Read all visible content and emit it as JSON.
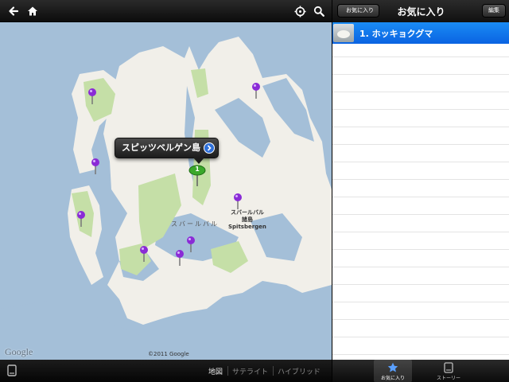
{
  "map": {
    "topbar": {
      "back_icon": "arrow-left-icon",
      "home_icon": "home-icon",
      "locate_icon": "crosshair-icon",
      "search_icon": "search-icon"
    },
    "callout": {
      "title": "スピッツベルゲン島",
      "disclosure_icon": "chevron-right-circle-icon"
    },
    "selected_pin_number": "1",
    "labels": {
      "island_ja": "スバールバル",
      "archipelago_ja_line1": "スバールバル",
      "archipelago_ja_line2": "諸島",
      "archipelago_en": "Spitsbergen"
    },
    "logo_text": "Google",
    "copyright": "©2011 Google",
    "bottombar": {
      "book_icon": "book-icon",
      "segments": [
        "地図",
        "サテライト",
        "ハイブリッド"
      ],
      "active_segment": "地図"
    },
    "colors": {
      "water": "#a4bfd8",
      "land": "#f1efe9",
      "park": "#c5dfa7",
      "pin_purple": "#8a2bd6",
      "pin_green": "#3aa82b"
    }
  },
  "side": {
    "back_label": "お気に入り",
    "title": "お気に入り",
    "edit_label": "編集",
    "items": [
      {
        "label": "1. ホッキョクグマ",
        "selected": true
      }
    ],
    "tabs": [
      {
        "label": "お気に入り",
        "icon": "star-icon",
        "active": true
      },
      {
        "label": "ストーリー",
        "icon": "book-icon",
        "active": false
      }
    ],
    "colors": {
      "selected_row": "#0a63e2",
      "tab_star": "#5aa0ff"
    }
  }
}
